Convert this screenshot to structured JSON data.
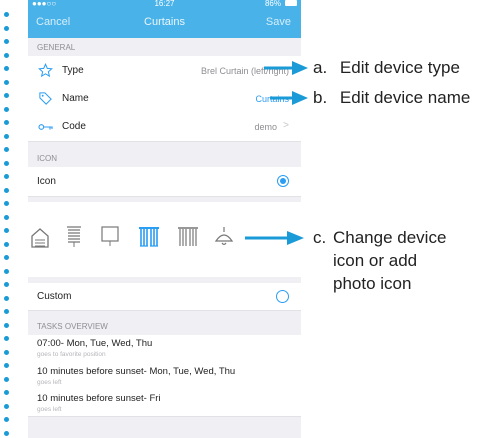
{
  "status_bar": {
    "signal": "●●●○○",
    "time": "16:27",
    "battery": "86%"
  },
  "nav": {
    "cancel": "Cancel",
    "title": "Curtains",
    "save": "Save"
  },
  "general": {
    "header": "GENERAL",
    "type": {
      "label": "Type",
      "value": "Brel Curtain (left/right)"
    },
    "name": {
      "label": "Name",
      "value": "Curtains"
    },
    "code": {
      "label": "Code",
      "value": "demo"
    }
  },
  "icon_section": {
    "header": "ICON",
    "icon_label": "Icon",
    "icon_selected": true,
    "icons": [
      "house-icon",
      "blinds-icon",
      "screen-icon",
      "curtain-icon",
      "curtain-2-icon",
      "lamp-icon"
    ],
    "selected_icon": "curtain-icon",
    "custom_label": "Custom",
    "custom_selected": false
  },
  "tasks": {
    "header": "TASKS OVERVIEW",
    "items": [
      {
        "title": "07:00- Mon, Tue, Wed, Thu",
        "subtitle": "goes to favorite position"
      },
      {
        "title": "10 minutes before sunset- Mon, Tue, Wed, Thu",
        "subtitle": "goes left"
      },
      {
        "title": "10 minutes before sunset- Fri",
        "subtitle": "goes left"
      }
    ]
  },
  "annotations": {
    "a_letter": "a.",
    "a_text": "Edit device type",
    "b_letter": "b.",
    "b_text": "Edit device name",
    "c_letter": "c.",
    "c_line1": "Change device",
    "c_line2": "icon or add",
    "c_line3": "photo icon"
  },
  "colors": {
    "accent": "#49b2e8",
    "link": "#2a9df4",
    "arrow": "#1a9bd7"
  }
}
